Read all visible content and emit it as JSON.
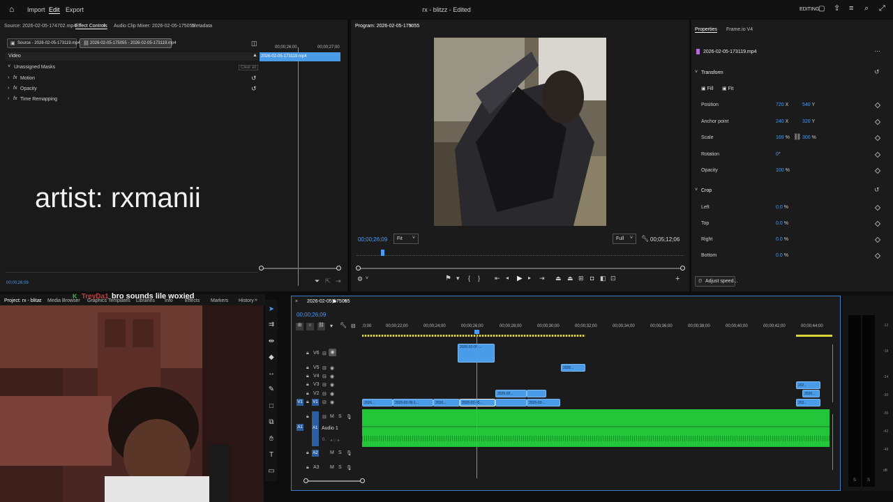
{
  "app": {
    "menu": [
      "Import",
      "Edit",
      "Export"
    ],
    "active_menu": "Edit",
    "title": "rx - blitzz - Edited",
    "workspace_label": "EDITING"
  },
  "source_panel": {
    "tabs": [
      "Source: 2026-02-05-174702.mp4",
      "Effect Controls",
      "Audio Clip Mixer: 2026-02-05-175055",
      "Metadata"
    ],
    "active_tab": "Effect Controls",
    "source_chip": "Source - 2026-02-05-173119.mp4",
    "sequence_chip": "2026-02-05-175055 - 2026-02-05-173119.mp4",
    "mini_timecodes": [
      "00;00;26;00",
      "00;00;27;00"
    ],
    "mini_clip_label": "2026-02-05-173119.mp4",
    "section_video": "Video",
    "rows": [
      "Unassigned Masks",
      "Motion",
      "Opacity",
      "Time Remapping"
    ],
    "clear_all": "Clear all",
    "overlay_text": "artist: rxmanii",
    "timecode": "00;00;26;09"
  },
  "program_panel": {
    "title": "Program: 2026-02-05-175055",
    "timecode": "00;00;26;09",
    "fit_label": "Fit",
    "quality_label": "Full",
    "duration": "00;05;12;06"
  },
  "properties_panel": {
    "tabs": [
      "Properties",
      "Frame.io V4"
    ],
    "clip_name": "2026-02-05-173119.mp4",
    "transform_title": "Transform",
    "fill_label": "Fill",
    "fit_label": "Fit",
    "position": {
      "label": "Position",
      "x": "720",
      "x_unit": "X",
      "y": "540",
      "y_unit": "Y"
    },
    "anchor": {
      "label": "Anchor point",
      "x": "240",
      "x_unit": "X",
      "y": "320",
      "y_unit": "Y"
    },
    "scale": {
      "label": "Scale",
      "a": "169",
      "a_unit": "%",
      "b": "300",
      "b_unit": "%"
    },
    "rotation": {
      "label": "Rotation",
      "value": "0",
      "unit": "°"
    },
    "opacity": {
      "label": "Opacity",
      "value": "100",
      "unit": "%"
    },
    "crop_title": "Crop",
    "crop": [
      {
        "label": "Left",
        "value": "0.0",
        "unit": "%"
      },
      {
        "label": "Top",
        "value": "0.0",
        "unit": "%"
      },
      {
        "label": "Right",
        "value": "0.0",
        "unit": "%"
      },
      {
        "label": "Bottom",
        "value": "0.0",
        "unit": "%"
      }
    ],
    "adjust_speed": "Adjust speed..."
  },
  "project_panel": {
    "tabs": [
      "Project: rx - blitzz",
      "Media Browser",
      "Graphics Templates",
      "Libraries",
      "Info",
      "Effects",
      "Markers",
      "History"
    ]
  },
  "chat": {
    "username": "TreyDa1",
    "message": "bro sounds lile woxied"
  },
  "timeline": {
    "sequence_name": "2026-02-05-175055",
    "timecode": "00;00;26;09",
    "ruler": [
      "00;00;22;00",
      "00;00;24;00",
      "00;00;26;00",
      "00;00;28;00",
      "00;00;30;00",
      "00;00;32;00",
      "00;00;34;00",
      "00;00;36;00",
      "00;00;38;00",
      "00;00;40;00",
      "00;00;42;00",
      "00;00;44;00"
    ],
    "ruler_start": ";0;00",
    "video_tracks": [
      "V6",
      "V5",
      "V4",
      "V3",
      "V2",
      "V1"
    ],
    "audio_tracks": [
      "A1",
      "A2",
      "A3"
    ],
    "audio_track_name": "Audio 1",
    "clip_labels": {
      "v6": "2026-02-05-...",
      "v5": "2026...",
      "v2a": "2026-02...",
      "v1a": "2026...",
      "v1b": "2026-02-05-1...",
      "v1c": "2026...",
      "v1d": "2026-02-05...",
      "v1e": "2026-03-...",
      "v3r": "202...",
      "v2r": "2026...",
      "v1r": "202..."
    },
    "meter_labels": [
      "-12",
      "-18",
      "-24",
      "-30",
      "-36",
      "-42",
      "-48",
      "dB"
    ],
    "meter_footer": [
      "S",
      "S"
    ]
  }
}
